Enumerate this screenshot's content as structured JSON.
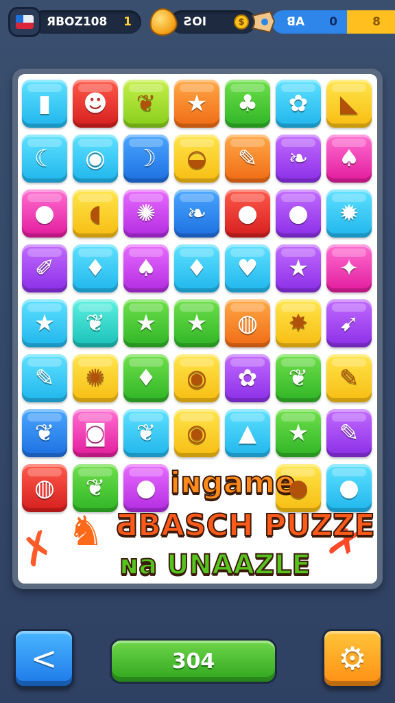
{
  "hud": {
    "player": {
      "name": "ЯBOZ108",
      "level": "1"
    },
    "lives": {
      "value": "ƧOI"
    },
    "tickets": {
      "a": "ꓭA",
      "b": "0",
      "c": "8"
    }
  },
  "board": {
    "rows": [
      [
        {
          "c": "cyan",
          "g": "▮",
          "n": "battery"
        },
        {
          "c": "red",
          "g": "☻",
          "n": "face"
        },
        {
          "c": "lime",
          "g": "❦",
          "n": "pepper"
        },
        {
          "c": "orange",
          "g": "★",
          "n": "star"
        },
        {
          "c": "green",
          "g": "♣",
          "n": "blob"
        },
        {
          "c": "cyan",
          "g": "✿",
          "n": "flower"
        },
        {
          "c": "yellow",
          "g": "◣",
          "n": "triangle"
        }
      ],
      [
        {
          "c": "cyan",
          "g": "☾",
          "n": "banana"
        },
        {
          "c": "cyan",
          "g": "◉",
          "n": "egg"
        },
        {
          "c": "blue",
          "g": "☽",
          "n": "moon"
        },
        {
          "c": "yellow",
          "g": "◒",
          "n": "shell"
        },
        {
          "c": "orange",
          "g": "✎",
          "n": "wand"
        },
        {
          "c": "purple",
          "g": "❧",
          "n": "leaf"
        },
        {
          "c": "pink",
          "g": "♠",
          "n": "berry"
        }
      ],
      [
        {
          "c": "pink",
          "g": "●",
          "n": "pumpkin"
        },
        {
          "c": "yellow",
          "g": "◖",
          "n": "bubble"
        },
        {
          "c": "magenta",
          "g": "✺",
          "n": "gear"
        },
        {
          "c": "blue",
          "g": "❧",
          "n": "leaf"
        },
        {
          "c": "red",
          "g": "●",
          "n": "apple"
        },
        {
          "c": "purple",
          "g": "●",
          "n": "plum"
        },
        {
          "c": "cyan",
          "g": "✹",
          "n": "splash"
        }
      ],
      [
        {
          "c": "purple",
          "g": "✐",
          "n": "pencil"
        },
        {
          "c": "cyan",
          "g": "♦",
          "n": "drop"
        },
        {
          "c": "magenta",
          "g": "♠",
          "n": "turnip"
        },
        {
          "c": "cyan",
          "g": "♦",
          "n": "drop"
        },
        {
          "c": "cyan",
          "g": "♥",
          "n": "bean"
        },
        {
          "c": "purple",
          "g": "★",
          "n": "star"
        },
        {
          "c": "pink",
          "g": "✦",
          "n": "sparkle"
        }
      ],
      [
        {
          "c": "cyan",
          "g": "★",
          "n": "star"
        },
        {
          "c": "teal",
          "g": "❦",
          "n": "leaf"
        },
        {
          "c": "green",
          "g": "★",
          "n": "star"
        },
        {
          "c": "green",
          "g": "★",
          "n": "star-face"
        },
        {
          "c": "orange",
          "g": "◍",
          "n": "ball"
        },
        {
          "c": "yellow",
          "g": "✸",
          "n": "burst"
        },
        {
          "c": "purple",
          "g": "➹",
          "n": "rocket"
        }
      ],
      [
        {
          "c": "cyan",
          "g": "✎",
          "n": "crayon"
        },
        {
          "c": "yellow",
          "g": "✺",
          "n": "sun"
        },
        {
          "c": "green",
          "g": "♦",
          "n": "gem"
        },
        {
          "c": "yellow",
          "g": "◉",
          "n": "eye"
        },
        {
          "c": "purple",
          "g": "✿",
          "n": "corn"
        },
        {
          "c": "green",
          "g": "❦",
          "n": "leaf"
        },
        {
          "c": "yellow",
          "g": "✎",
          "n": "knife"
        }
      ],
      [
        {
          "c": "blue",
          "g": "❦",
          "n": "leaf"
        },
        {
          "c": "pink",
          "g": "◙",
          "n": "basket"
        },
        {
          "c": "cyan",
          "g": "❦",
          "n": "leaf"
        },
        {
          "c": "yellow",
          "g": "◉",
          "n": "citrus"
        },
        {
          "c": "cyan",
          "g": "▲",
          "n": "cone"
        },
        {
          "c": "green",
          "g": "★",
          "n": "star-face"
        },
        {
          "c": "purple",
          "g": "✎",
          "n": "carrot"
        }
      ],
      [
        {
          "c": "red",
          "g": "◍",
          "n": "ball"
        },
        {
          "c": "green",
          "g": "❦",
          "n": "leaf"
        },
        {
          "c": "magenta",
          "g": "●",
          "n": "onion"
        },
        {
          "c": "white",
          "g": "",
          "n": "blank"
        },
        {
          "c": "white",
          "g": "",
          "n": "blank"
        },
        {
          "c": "yellow",
          "g": "●",
          "n": "lemon"
        },
        {
          "c": "cyan",
          "g": "●",
          "n": "drop"
        }
      ]
    ]
  },
  "title": {
    "line1": "iɴgame",
    "line2": "ƋBASCH PUZZE",
    "line3": "ɴa UNAAZLE"
  },
  "bottom": {
    "score": "304"
  }
}
